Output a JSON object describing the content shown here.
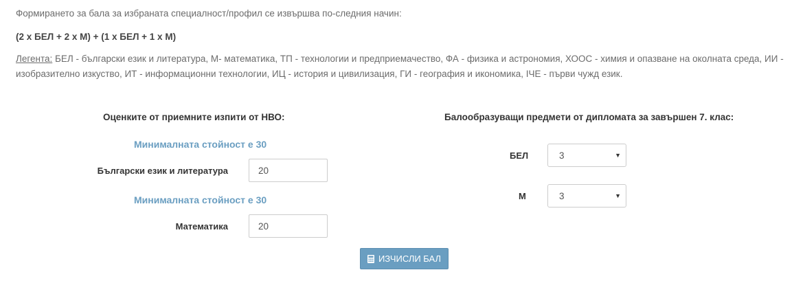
{
  "intro": {
    "text": "Формирането за бала за избраната специалност/профил се извършва по-следния начин:",
    "formula": "(2 x БЕЛ + 2 x М) + (1 x БЕЛ + 1 x М)",
    "legend_label": "Легента:",
    "legend_text": " БЕЛ - български език и литература, М- математика, ТП - технологии и предприемачество, ФА - физика и астрономия, ХООС - химия и опазване на околната среда, ИИ - изобразително изкуство, ИТ - информационни технологии, ИЦ - история и цивилизация, ГИ - география и икономика, IЧЕ - първи чужд език."
  },
  "exams": {
    "title": "Оценките от приемните изпити от НВО:",
    "fields": [
      {
        "min_note": "Минималната стойност е 30",
        "label": "Български език и литература",
        "value": "20"
      },
      {
        "min_note": "Минималната стойност е 30",
        "label": "Математика",
        "value": "20"
      }
    ]
  },
  "diploma": {
    "title": "Балообразуващи предмети от дипломата за завършен 7. клас:",
    "fields": [
      {
        "label": "БЕЛ",
        "selected": "3"
      },
      {
        "label": "М",
        "selected": "3"
      }
    ]
  },
  "button": {
    "label": "ИЗЧИСЛИ БАЛ",
    "icon": "calculator-icon"
  },
  "colors": {
    "accent": "#6a9ec1",
    "text": "#555555"
  }
}
